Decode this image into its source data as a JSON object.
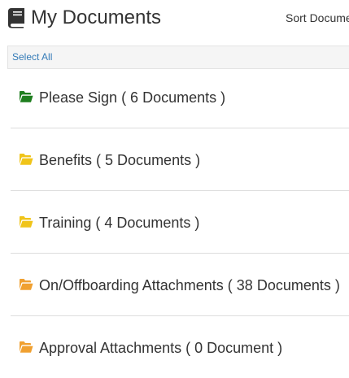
{
  "header": {
    "title": "My Documents",
    "sort_label": "Sort Docume",
    "title_icon": "book-icon"
  },
  "toolbar": {
    "select_all_label": "Select All"
  },
  "folders": [
    {
      "label": "Please Sign ( 6 Documents )",
      "icon": "folder-open-icon",
      "color": "#1e7e1e"
    },
    {
      "label": "Benefits ( 5 Documents )",
      "icon": "folder-open-icon",
      "color": "#f0c419"
    },
    {
      "label": "Training ( 4 Documents )",
      "icon": "folder-open-icon",
      "color": "#f0c419"
    },
    {
      "label": "On/Offboarding Attachments ( 38 Documents )",
      "icon": "folder-open-icon",
      "color": "#f0a030"
    },
    {
      "label": "Approval Attachments ( 0 Document )",
      "icon": "folder-open-icon",
      "color": "#f0a030"
    }
  ]
}
